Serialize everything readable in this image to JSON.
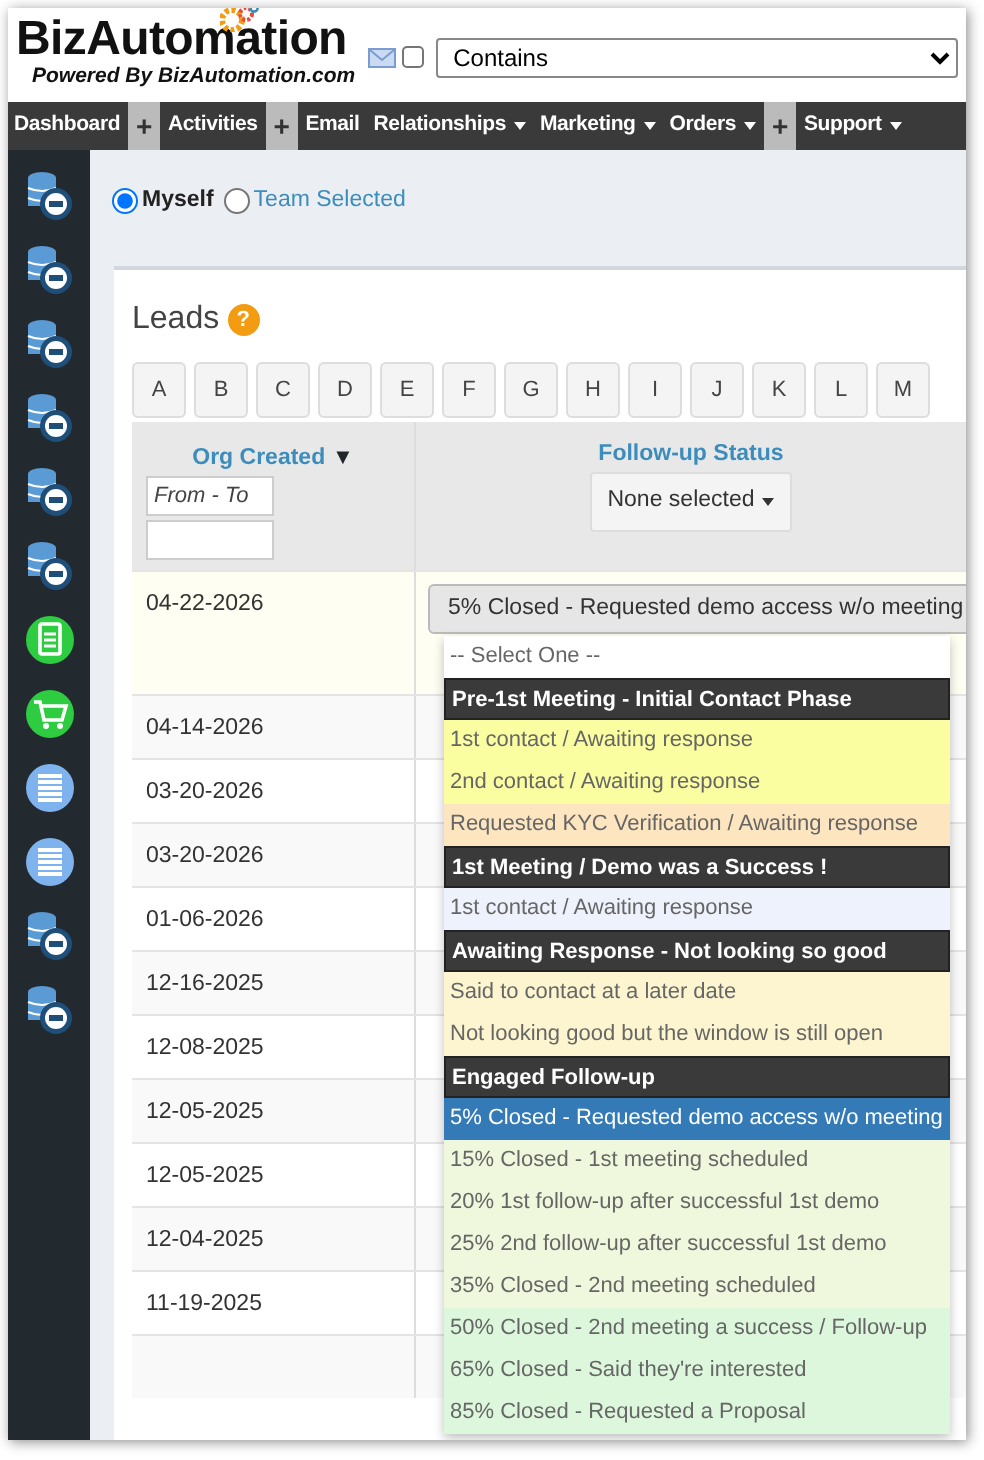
{
  "header": {
    "logo": "BizAutomation",
    "tagline": "Powered By BizAutomation.com",
    "search_mode": {
      "value": "Contains"
    },
    "email_checkbox": {
      "checked": false
    }
  },
  "nav": [
    {
      "label": "Dashboard",
      "kind": "link"
    },
    {
      "label": "+",
      "kind": "plus"
    },
    {
      "label": "Activities",
      "kind": "link"
    },
    {
      "label": "+",
      "kind": "plus"
    },
    {
      "label": "Email",
      "kind": "link"
    },
    {
      "label": "Relationships",
      "kind": "menu"
    },
    {
      "label": "Marketing",
      "kind": "menu"
    },
    {
      "label": "Orders",
      "kind": "menu"
    },
    {
      "label": "+",
      "kind": "plus"
    },
    {
      "label": "Support",
      "kind": "menu"
    }
  ],
  "sidebar": [
    {
      "kind": "database"
    },
    {
      "kind": "database"
    },
    {
      "kind": "database"
    },
    {
      "kind": "database"
    },
    {
      "kind": "database"
    },
    {
      "kind": "database"
    },
    {
      "kind": "document"
    },
    {
      "kind": "cart"
    },
    {
      "kind": "stack"
    },
    {
      "kind": "stack"
    },
    {
      "kind": "database"
    },
    {
      "kind": "database"
    }
  ],
  "scope": [
    {
      "label": "Myself",
      "selected": true
    },
    {
      "label": "Team Selected",
      "selected": false
    }
  ],
  "panel": {
    "title": "Leads",
    "help": "?"
  },
  "letters": [
    {
      "label": "A"
    },
    {
      "label": "B"
    },
    {
      "label": "C"
    },
    {
      "label": "D"
    },
    {
      "label": "E"
    },
    {
      "label": "F"
    },
    {
      "label": "G"
    },
    {
      "label": "H"
    },
    {
      "label": "I"
    },
    {
      "label": "J"
    },
    {
      "label": "K"
    },
    {
      "label": "L"
    },
    {
      "label": "M"
    }
  ],
  "table": {
    "columns": [
      {
        "label": "Org Created",
        "sort": "▼",
        "filter_placeholder": "From - To"
      },
      {
        "label": "Follow-up Status",
        "filter": "None selected"
      }
    ],
    "rows": [
      {
        "date": "04-22-2026",
        "status": "5% Closed - Requested demo access w/o meeting",
        "open": true
      },
      {
        "date": "04-14-2026"
      },
      {
        "date": "03-20-2026"
      },
      {
        "date": "03-20-2026"
      },
      {
        "date": "01-06-2026"
      },
      {
        "date": "12-16-2025"
      },
      {
        "date": "12-08-2025"
      },
      {
        "date": "12-05-2025"
      },
      {
        "date": "12-05-2025"
      },
      {
        "date": "12-04-2025"
      },
      {
        "date": "11-19-2025"
      },
      {}
    ]
  },
  "status_options": [
    {
      "kind": "option",
      "label": "-- Select One --",
      "color": "#ffffff",
      "selected": false
    },
    {
      "kind": "group",
      "label": "Pre-1st Meeting - Initial Contact Phase"
    },
    {
      "kind": "option",
      "label": "1st contact / Awaiting response",
      "color": "#fafea0",
      "selected": false
    },
    {
      "kind": "option",
      "label": "2nd contact / Awaiting response",
      "color": "#fafea0",
      "selected": false
    },
    {
      "kind": "option",
      "label": "Requested KYC Verification / Awaiting response",
      "color": "#fde5c0",
      "selected": false
    },
    {
      "kind": "group",
      "label": "1st Meeting / Demo was a Success !"
    },
    {
      "kind": "option",
      "label": "1st contact / Awaiting response",
      "color": "#eef2fc",
      "selected": false
    },
    {
      "kind": "group",
      "label": "Awaiting Response - Not looking so good"
    },
    {
      "kind": "option",
      "label": "Said to contact at a later date",
      "color": "#fdf5cf",
      "selected": false
    },
    {
      "kind": "option",
      "label": "Not looking good but the window is still open",
      "color": "#fdf5cf",
      "selected": false
    },
    {
      "kind": "group",
      "label": "Engaged Follow-up"
    },
    {
      "kind": "option",
      "label": "5% Closed - Requested demo access w/o meeting",
      "color": "#337ab7",
      "selected": true
    },
    {
      "kind": "option",
      "label": "15% Closed - 1st meeting scheduled",
      "color": "#eff8dc",
      "selected": false
    },
    {
      "kind": "option",
      "label": "20% 1st follow-up after successful 1st demo",
      "color": "#eff8dc",
      "selected": false
    },
    {
      "kind": "option",
      "label": "25% 2nd follow-up after successful 1st demo",
      "color": "#eff8dc",
      "selected": false
    },
    {
      "kind": "option",
      "label": "35% Closed - 2nd meeting scheduled",
      "color": "#eff8dc",
      "selected": false
    },
    {
      "kind": "option",
      "label": "50% Closed - 2nd meeting a success / Follow-up",
      "color": "#ddf7dd",
      "selected": false
    },
    {
      "kind": "option",
      "label": "65% Closed - Said they're interested",
      "color": "#ddf7dd",
      "selected": false
    },
    {
      "kind": "option",
      "label": "85% Closed - Requested a Proposal",
      "color": "#ddf7dd",
      "selected": false
    }
  ]
}
